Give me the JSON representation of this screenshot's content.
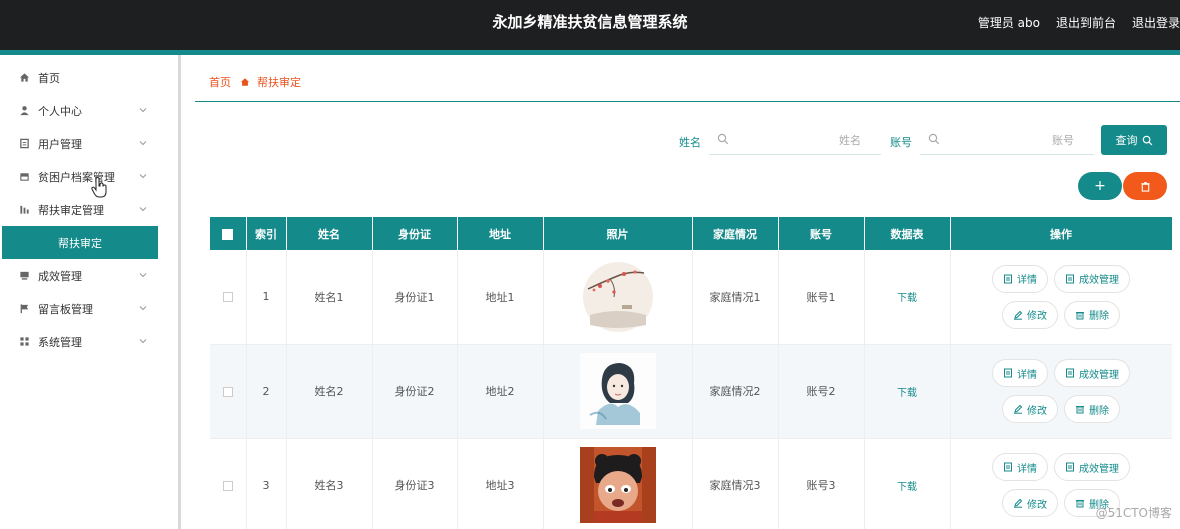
{
  "header": {
    "title": "永加乡精准扶贫信息管理系统",
    "admin_label": "管理员 abo",
    "back_front_label": "退出到前台",
    "logout_label": "退出登录"
  },
  "sidebar": {
    "items": [
      {
        "label": "首页",
        "icon": "home-icon"
      },
      {
        "label": "个人中心",
        "icon": "user-icon"
      },
      {
        "label": "用户管理",
        "icon": "users-icon"
      },
      {
        "label": "贫困户档案管理",
        "icon": "archive-icon"
      },
      {
        "label": "帮扶审定管理",
        "icon": "chart-icon"
      },
      {
        "label": "成效管理",
        "icon": "list-icon"
      },
      {
        "label": "留言板管理",
        "icon": "flag-icon"
      },
      {
        "label": "系统管理",
        "icon": "grid-icon"
      }
    ],
    "active_sub": "帮扶审定"
  },
  "breadcrumb": {
    "home": "首页",
    "current": "帮扶审定"
  },
  "search": {
    "name_label": "姓名",
    "name_placeholder": "姓名",
    "account_label": "账号",
    "account_placeholder": "账号",
    "query_label": "查询"
  },
  "actions": {
    "add_symbol": "+",
    "delete_symbol": "🗑"
  },
  "table": {
    "headers": [
      "",
      "索引",
      "姓名",
      "身份证",
      "地址",
      "照片",
      "家庭情况",
      "账号",
      "数据表",
      "操作"
    ],
    "rows": [
      {
        "index": "1",
        "name": "姓名1",
        "idcard": "身份证1",
        "address": "地址1",
        "family": "家庭情况1",
        "account": "账号1",
        "download": "下载",
        "photo": "plum-blossom-painting"
      },
      {
        "index": "2",
        "name": "姓名2",
        "idcard": "身份证2",
        "address": "地址2",
        "family": "家庭情况2",
        "account": "账号2",
        "download": "下载",
        "photo": "ink-wash-portrait"
      },
      {
        "index": "3",
        "name": "姓名3",
        "idcard": "身份证3",
        "address": "地址3",
        "family": "家庭情况3",
        "account": "账号3",
        "download": "下载",
        "photo": "cartoon-character"
      }
    ],
    "ops": {
      "detail": "详情",
      "outcome": "成效管理",
      "edit": "修改",
      "delete": "删除"
    }
  },
  "watermark": "@51CTO博客",
  "colors": {
    "accent": "#148a8a",
    "danger": "#f15a1a",
    "topbar": "#1e1f21",
    "breadcrumb": "#e8541e"
  }
}
